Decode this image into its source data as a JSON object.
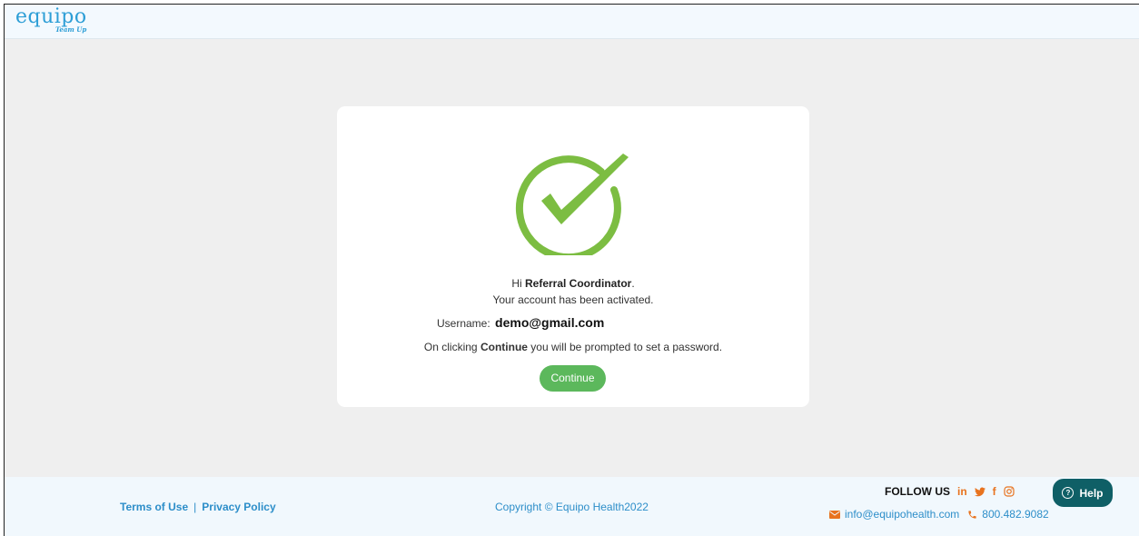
{
  "header": {
    "logo_text": "equipo",
    "logo_tagline": "Team Up"
  },
  "card": {
    "greeting_prefix": "Hi ",
    "user_role": "Referral Coordinator",
    "greeting_suffix": ".",
    "activated_message": "Your account has been activated.",
    "username_label": "Username:",
    "username_value": "demo@gmail.com",
    "prompt_prefix": "On clicking ",
    "prompt_keyword": "Continue",
    "prompt_suffix": " you will be prompted to set a password.",
    "continue_label": "Continue"
  },
  "footer": {
    "terms_label": "Terms of Use",
    "separator": "|",
    "privacy_label": "Privacy Policy",
    "copyright": "Copyright © Equipo Health2022",
    "follow_label": "FOLLOW US",
    "social_icons": [
      "linkedin-icon",
      "twitter-icon",
      "facebook-icon",
      "instagram-icon"
    ],
    "email": "info@equipohealth.com",
    "phone": "800.482.9082"
  },
  "help": {
    "label": "Help"
  },
  "colors": {
    "accent_blue": "#2d8ec9",
    "success_green": "#5cb85c",
    "check_green": "#7cbd42",
    "social_orange": "#e8731f",
    "help_teal": "#0f5f66"
  }
}
